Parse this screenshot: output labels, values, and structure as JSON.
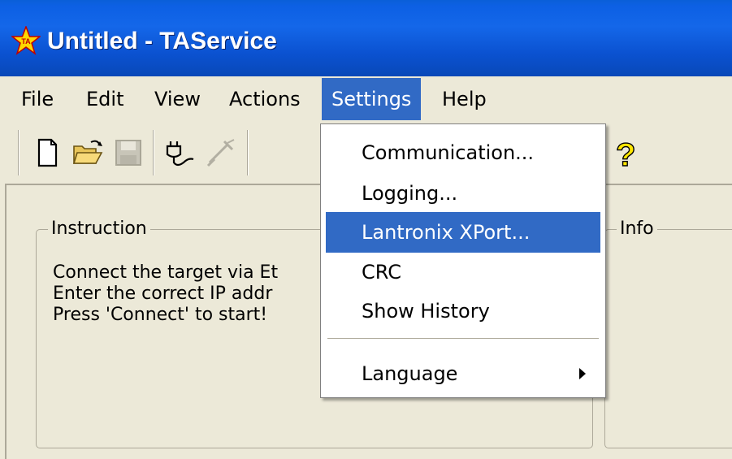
{
  "window": {
    "title": "Untitled - TAService",
    "icon": "app-star-icon"
  },
  "menubar": {
    "items": [
      {
        "label": "File"
      },
      {
        "label": "Edit"
      },
      {
        "label": "View"
      },
      {
        "label": "Actions"
      },
      {
        "label": "Settings",
        "active": true
      },
      {
        "label": "Help"
      }
    ]
  },
  "toolbar": {
    "buttons": [
      {
        "icon": "new-document-icon",
        "enabled": true
      },
      {
        "icon": "open-folder-icon",
        "enabled": true
      },
      {
        "icon": "save-disk-icon",
        "enabled": false
      },
      {
        "icon": "connect-plug-icon",
        "enabled": true
      },
      {
        "icon": "disconnect-plug-icon",
        "enabled": false
      },
      {
        "icon": "help-question-icon",
        "enabled": true
      }
    ]
  },
  "settings_menu": {
    "items": [
      {
        "label": "Communication..."
      },
      {
        "label": "Logging..."
      },
      {
        "label": "Lantronix XPort...",
        "highlighted": true
      },
      {
        "label": "CRC"
      },
      {
        "label": "Show History"
      },
      {
        "label": "Language",
        "submenu": true
      }
    ]
  },
  "instruction": {
    "title": "Instruction",
    "lines": [
      "Connect the target via Et",
      "Enter the correct IP addr",
      "Press 'Connect' to start!"
    ]
  },
  "info": {
    "title": "Info"
  },
  "colors": {
    "titlebar": "#0b5ad9",
    "highlight": "#316ac5",
    "face": "#ece9d8"
  }
}
